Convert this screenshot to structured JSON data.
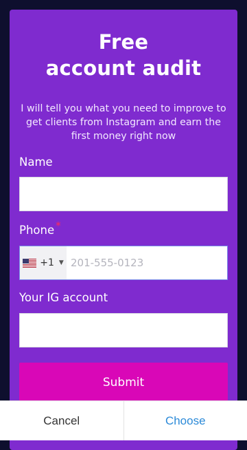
{
  "form": {
    "title_line1": "Free",
    "title_line2": "account audit",
    "subtitle": "I will tell you what you need to improve to get clients from Instagram and earn the first money right now",
    "name_label": "Name",
    "phone_label": "Phone",
    "required_mark": "*",
    "phone_country_code": "+1",
    "phone_country_flag": "us-flag-icon",
    "phone_placeholder": "201-555-0123",
    "ig_label": "Your IG account",
    "submit_label": "Submit"
  },
  "dialog": {
    "cancel_label": "Cancel",
    "choose_label": "Choose"
  },
  "colors": {
    "background": "#0e0f2e",
    "card": "#7f2bcf",
    "submit": "#d907b7",
    "choose_text": "#2c8ad8"
  }
}
